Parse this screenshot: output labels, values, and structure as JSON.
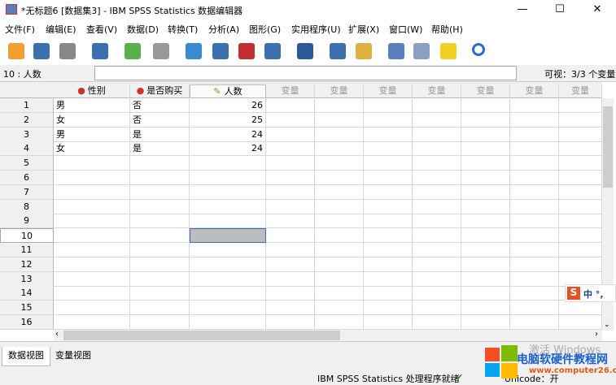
{
  "window": {
    "title": "*无标题6 [数据集3] - IBM SPSS Statistics 数据编辑器",
    "minimize": "—",
    "maximize": "☐",
    "close": "✕"
  },
  "menu": [
    "文件(F)",
    "编辑(E)",
    "查看(V)",
    "数据(D)",
    "转换(T)",
    "分析(A)",
    "图形(G)",
    "实用程序(U)",
    "扩展(X)",
    "窗口(W)",
    "帮助(H)"
  ],
  "toolbar": [
    "open-icon",
    "save-icon",
    "print-icon",
    "dialog-recall-icon",
    "undo-icon",
    "redo-icon",
    "goto-case-icon",
    "goto-variable-icon",
    "variables-icon",
    "run-descriptives-icon",
    "find-icon",
    "insert-cases-icon",
    "insert-variable-icon",
    "split-file-icon",
    "value-labels-icon",
    "use-variable-sets-icon",
    "search-icon"
  ],
  "cell_editor": {
    "ref": "10 : 人数",
    "value": "",
    "visible": "可视：3/3 个变量"
  },
  "columns": [
    {
      "name": "性别",
      "type": "nominal"
    },
    {
      "name": "是否购买",
      "type": "nominal"
    },
    {
      "name": "人数",
      "type": "scale"
    }
  ],
  "empty_column_label": "变量",
  "rows": [
    [
      "男",
      "否",
      "26"
    ],
    [
      "女",
      "否",
      "25"
    ],
    [
      "男",
      "是",
      "24"
    ],
    [
      "女",
      "是",
      "24"
    ]
  ],
  "row_numbers": [
    "1",
    "2",
    "3",
    "4",
    "5",
    "6",
    "7",
    "8",
    "9",
    "10",
    "11",
    "12",
    "13",
    "14",
    "15",
    "16"
  ],
  "selected_cell": {
    "row": "10",
    "column": "人数"
  },
  "tabs": {
    "data_view": "数据视图",
    "variable_view": "变量视图",
    "active": "数据视图"
  },
  "status": {
    "processor": "IBM SPSS Statistics 处理程序就绪",
    "unicode": "Unicode：开"
  },
  "overlay": {
    "activate": "激活 Windows",
    "watermark": "电脑软硬件教程网",
    "url": "www.computer26.com",
    "ime": "中 °,"
  }
}
